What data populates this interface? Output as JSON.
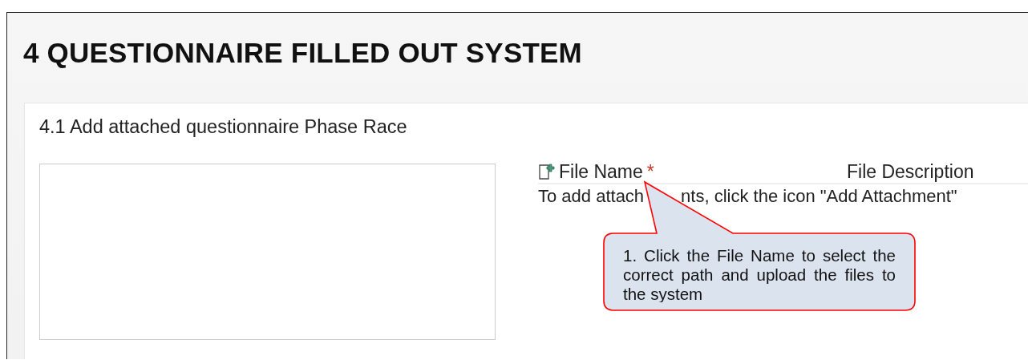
{
  "title": "4 QUESTIONNAIRE FILLED OUT SYSTEM",
  "section": {
    "heading": "4.1 Add attached questionnaire Phase Race",
    "attachments": {
      "columns": [
        {
          "label": "File Name",
          "mark": "*"
        },
        {
          "label": "File Description"
        }
      ],
      "hint": [
        "To add attach",
        "nts, click the icon \"Add Attachment\""
      ]
    }
  },
  "callout": {
    "text": "1. Click the File Name to select the correct path and upload the files to the system"
  }
}
